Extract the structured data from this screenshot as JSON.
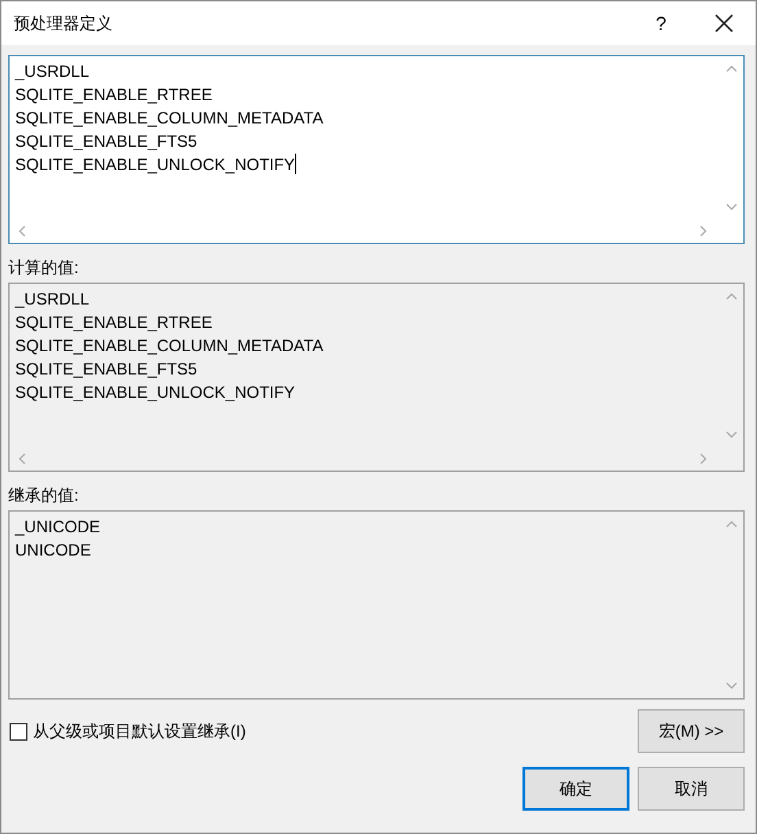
{
  "window": {
    "title": "预处理器定义",
    "help": "?"
  },
  "definitions": {
    "lines": [
      "_USRDLL",
      "SQLITE_ENABLE_RTREE",
      "SQLITE_ENABLE_COLUMN_METADATA",
      "SQLITE_ENABLE_FTS5",
      "SQLITE_ENABLE_UNLOCK_NOTIFY"
    ]
  },
  "computed_values": {
    "label": "计算的值:",
    "lines": [
      "_USRDLL",
      "SQLITE_ENABLE_RTREE",
      "SQLITE_ENABLE_COLUMN_METADATA",
      "SQLITE_ENABLE_FTS5",
      "SQLITE_ENABLE_UNLOCK_NOTIFY"
    ]
  },
  "inherited_values": {
    "label": "继承的值:",
    "lines": [
      "_UNICODE",
      "UNICODE"
    ]
  },
  "inherit_checkbox": {
    "label": "从父级或项目默认设置继承(I)",
    "checked": false
  },
  "macro_button": "宏(M) >>",
  "buttons": [
    {
      "label": "确定",
      "default": true
    },
    {
      "label": "取消",
      "default": false
    }
  ]
}
